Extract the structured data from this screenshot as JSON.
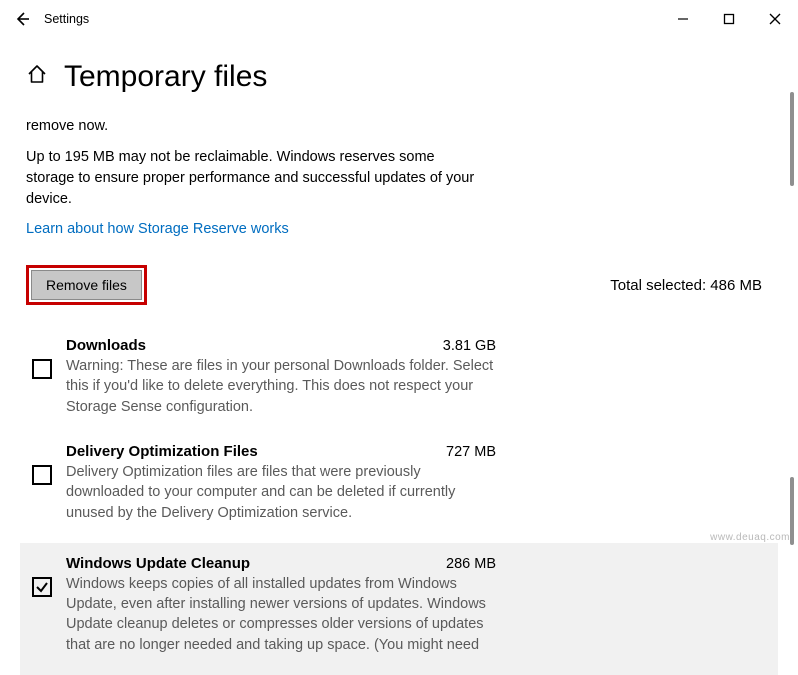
{
  "app_title": "Settings",
  "page_title": "Temporary files",
  "intro_partial": "remove now.",
  "intro2": "Up to 195 MB may not be reclaimable. Windows reserves some storage to ensure proper performance and successful updates of your device.",
  "link": "Learn about how Storage Reserve works",
  "remove_button": "Remove files",
  "total_label": "Total selected: 486 MB",
  "items": [
    {
      "title": "Downloads",
      "size": "3.81 GB",
      "checked": false,
      "desc": "Warning: These are files in your personal Downloads folder. Select this if you'd like to delete everything. This does not respect your Storage Sense configuration."
    },
    {
      "title": "Delivery Optimization Files",
      "size": "727 MB",
      "checked": false,
      "desc": "Delivery Optimization files are files that were previously downloaded to your computer and can be deleted if currently unused by the Delivery Optimization service."
    },
    {
      "title": "Windows Update Cleanup",
      "size": "286 MB",
      "checked": true,
      "desc": "Windows keeps copies of all installed updates from Windows Update, even after installing newer versions of updates. Windows Update cleanup deletes or compresses older versions of updates that are no longer needed and taking up space. (You might need"
    }
  ],
  "watermark": "www.deuaq.com"
}
